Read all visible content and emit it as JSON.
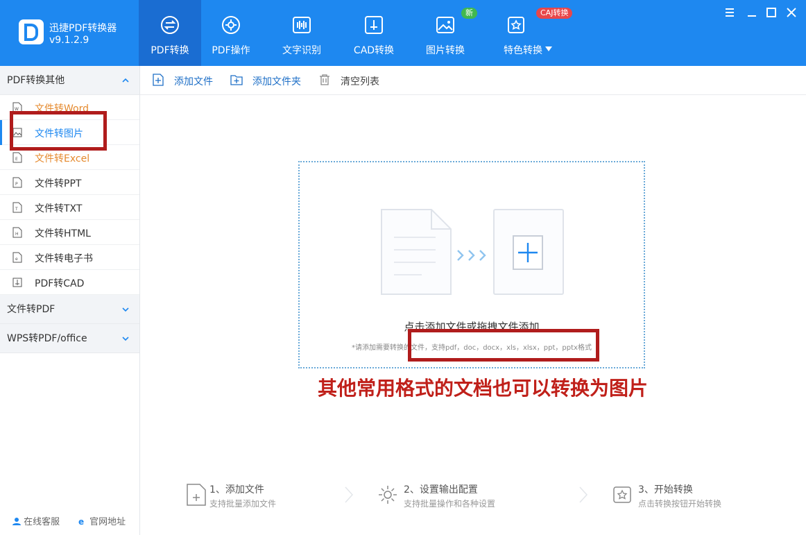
{
  "app": {
    "title": "迅捷PDF转换器",
    "version": "v9.1.2.9"
  },
  "nav": [
    {
      "label": "PDF转换",
      "icon": "pdf-convert-icon",
      "active": true
    },
    {
      "label": "PDF操作",
      "icon": "pdf-operation-icon",
      "active": false
    },
    {
      "label": "文字识别",
      "icon": "ocr-icon",
      "active": false
    },
    {
      "label": "CAD转换",
      "icon": "cad-icon",
      "active": false
    },
    {
      "label": "图片转换",
      "icon": "image-icon",
      "active": false,
      "badge": "新"
    },
    {
      "label": "特色转换",
      "icon": "special-icon",
      "active": false,
      "badge": "CAJ转换"
    }
  ],
  "sidebar": {
    "section1": {
      "label": "PDF转换其他",
      "expanded": true
    },
    "items": [
      {
        "label": "文件转Word",
        "icon": "W"
      },
      {
        "label": "文件转图片",
        "icon": "image"
      },
      {
        "label": "文件转Excel",
        "icon": "E"
      },
      {
        "label": "文件转PPT",
        "icon": "P"
      },
      {
        "label": "文件转TXT",
        "icon": "T"
      },
      {
        "label": "文件转HTML",
        "icon": "H"
      },
      {
        "label": "文件转电子书",
        "icon": "e"
      },
      {
        "label": "PDF转CAD",
        "icon": "cad"
      }
    ],
    "section2": {
      "label": "文件转PDF",
      "expanded": false
    },
    "section3": {
      "label": "WPS转PDF/office",
      "expanded": false
    },
    "footer": {
      "service": "在线客服",
      "website": "官网地址"
    }
  },
  "toolbar": {
    "add_file": "添加文件",
    "add_folder": "添加文件夹",
    "clear_list": "清空列表"
  },
  "dropzone": {
    "main": "点击添加文件或拖拽文件添加",
    "sub": "*请添加需要转换的文件，支持pdf，doc，docx，xls，xlsx，ppt，pptx格式"
  },
  "annotation": {
    "text": "其他常用格式的文档也可以转换为图片"
  },
  "steps": [
    {
      "title": "1、添加文件",
      "desc": "支持批量添加文件"
    },
    {
      "title": "2、设置输出配置",
      "desc": "支持批量操作和各种设置"
    },
    {
      "title": "3、开始转换",
      "desc": "点击转换按钮开始转换"
    }
  ],
  "colors": {
    "header": "#1e88f0",
    "header_active": "#1a6dd2",
    "accent": "#1e88f0",
    "orange": "#e58a2e",
    "annotation": "#c0201a"
  }
}
